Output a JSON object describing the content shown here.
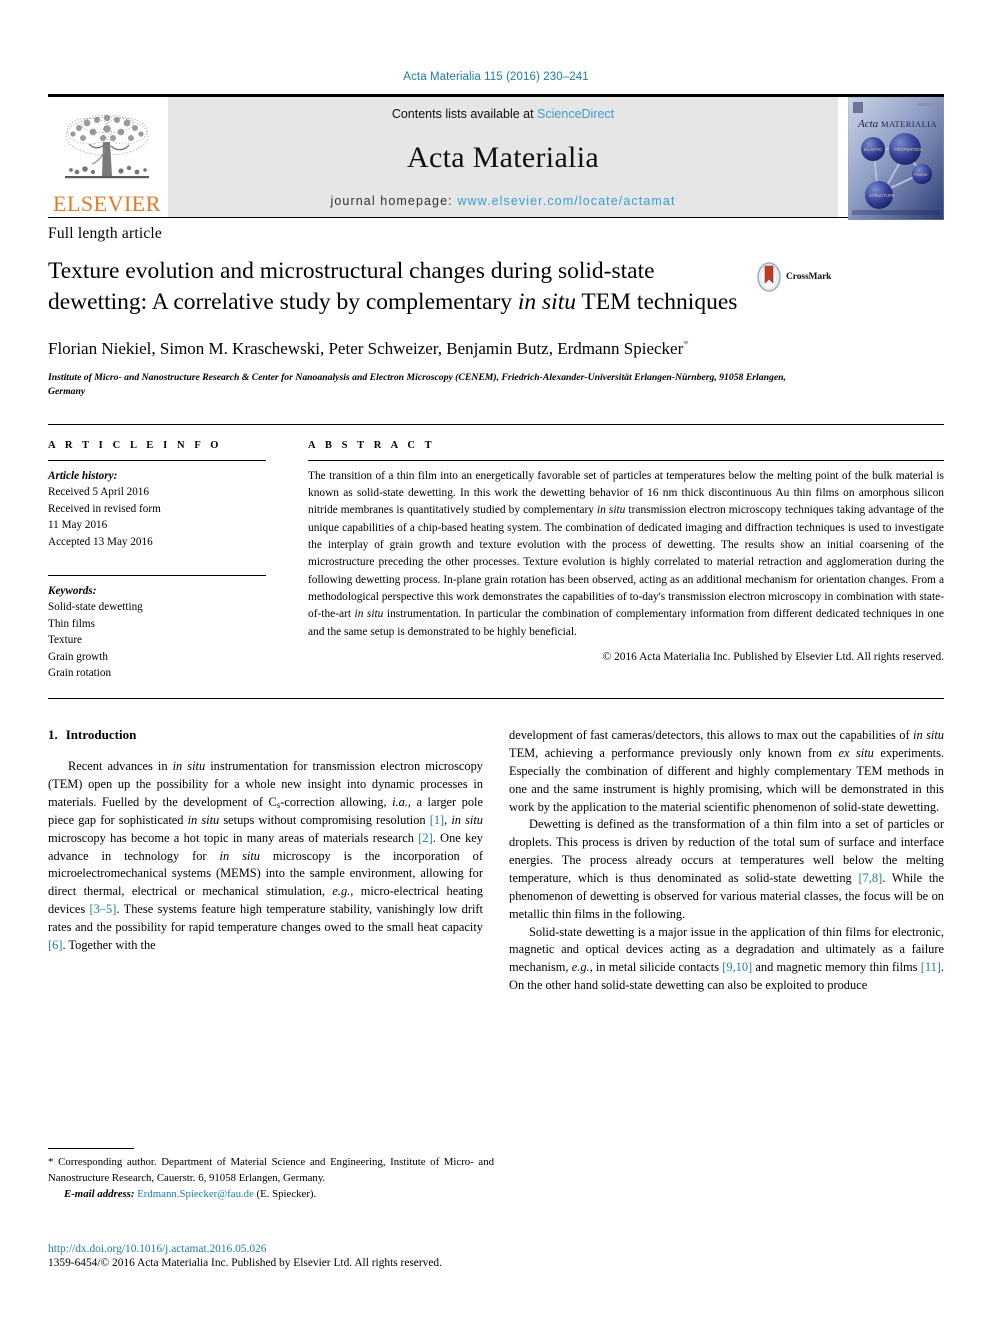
{
  "running_head": "Acta Materialia 115 (2016) 230–241",
  "masthead": {
    "publisher_name": "ELSEVIER",
    "contents_prefix": "Contents lists available at ",
    "contents_link": "ScienceDirect",
    "journal_title": "Acta Materialia",
    "homepage_prefix": "journal homepage: ",
    "homepage_link": "www.elsevier.com/locate/actamat",
    "cover_title_italic": "Acta",
    "cover_title_rest": "MATERIALIA"
  },
  "article": {
    "type": "Full length article",
    "title_part1": "Texture evolution and microstructural changes during solid-state dewetting: A correlative study by complementary ",
    "title_italic": "in situ",
    "title_part2": " TEM techniques",
    "crossmark_label": "CrossMark",
    "authors": "Florian Niekiel, Simon M. Kraschewski, Peter Schweizer, Benjamin Butz, Erdmann Spiecker",
    "author_marker": "*",
    "affiliation": "Institute of Micro- and Nanostructure Research & Center for Nanoanalysis and Electron Microscopy (CENEM), Friedrich-Alexander-Universität Erlangen-Nürnberg, 91058 Erlangen, Germany"
  },
  "article_info": {
    "heading": "A R T I C L E   I N F O",
    "history_label": "Article history:",
    "history_lines": [
      "Received 5 April 2016",
      "Received in revised form",
      "11 May 2016",
      "Accepted 13 May 2016"
    ],
    "keywords_label": "Keywords:",
    "keywords": [
      "Solid-state dewetting",
      "Thin films",
      "Texture",
      "Grain growth",
      "Grain rotation"
    ]
  },
  "abstract": {
    "heading": "A B S T R A C T",
    "p1": "The transition of a thin film into an energetically favorable set of particles at temperatures below the melting point of the bulk material is known as solid-state dewetting. In this work the dewetting behavior of 16 nm thick discontinuous Au thin films on amorphous silicon nitride membranes is quantitatively studied by complementary ",
    "italic1": "in situ",
    "p2": " transmission electron microscopy techniques taking advantage of the unique capabilities of a chip-based heating system. The combination of dedicated imaging and diffraction techniques is used to investigate the interplay of grain growth and texture evolution with the process of dewetting. The results show an initial coarsening of the microstructure preceding the other processes. Texture evolution is highly correlated to material retraction and agglomeration during the following dewetting process. In-plane grain rotation has been observed, acting as an additional mechanism for orientation changes. From a methodological perspective this work demonstrates the capabilities of to-day's transmission electron microscopy in combination with state-of-the-art ",
    "italic2": "in situ",
    "p3": " instrumentation. In particular the combination of complementary information from different dedicated techniques in one and the same setup is demonstrated to be highly beneficial.",
    "copyright": "© 2016 Acta Materialia Inc. Published by Elsevier Ltd. All rights reserved."
  },
  "introduction": {
    "number": "1.",
    "title": "Introduction",
    "left_p1_a": "Recent advances in ",
    "left_p1_i1": "in situ",
    "left_p1_b": " instrumentation for transmission electron microscopy (TEM) open up the possibility for a whole new insight into dynamic processes in materials. Fuelled by the development of C",
    "left_p1_sub": "s",
    "left_p1_c": "-correction allowing, ",
    "left_p1_i2": "i.a.",
    "left_p1_d": ", a larger pole piece gap for sophisticated ",
    "left_p1_i3": "in situ",
    "left_p1_e": " setups without compromising resolution ",
    "left_p1_r1": "[1]",
    "left_p1_f": ", ",
    "left_p1_i4": "in situ",
    "left_p1_g": " microscopy has become a hot topic in many areas of materials research ",
    "left_p1_r2": "[2]",
    "left_p1_h": ". One key advance in technology for ",
    "left_p1_i5": "in situ",
    "left_p1_j": " microscopy is the incorporation of microelectromechanical systems (MEMS) into the sample environment, allowing for direct thermal, electrical or mechanical stimulation, ",
    "left_p1_i6": "e.g.",
    "left_p1_k": ", micro-electrical heating devices ",
    "left_p1_r3": "[3–5]",
    "left_p1_l": ". These systems feature high temperature stability, vanishingly low drift rates and the possibility for rapid temperature changes owed to the small heat capacity ",
    "left_p1_r4": "[6]",
    "left_p1_m": ". Together with the",
    "right_p1_a": "development of fast cameras/detectors, this allows to max out the capabilities of ",
    "right_p1_i1": "in situ",
    "right_p1_b": " TEM, achieving a performance previously only known from ",
    "right_p1_i2": "ex situ",
    "right_p1_c": " experiments. Especially the combination of different and highly complementary TEM methods in one and the same instrument is highly promising, which will be demonstrated in this work by the application to the material scientific phenomenon of solid-state dewetting.",
    "right_p2": "Dewetting is defined as the transformation of a thin film into a set of particles or droplets. This process is driven by reduction of the total sum of surface and interface energies. The process already occurs at temperatures well below the melting temperature, which is thus denominated as solid-state dewetting ",
    "right_p2_r1": "[7,8]",
    "right_p2_b": ". While the phenomenon of dewetting is observed for various material classes, the focus will be on metallic thin films in the following.",
    "right_p3_a": "Solid-state dewetting is a major issue in the application of thin films for electronic, magnetic and optical devices acting as a degradation and ultimately as a failure mechanism, ",
    "right_p3_i1": "e.g.",
    "right_p3_b": ", in metal silicide contacts ",
    "right_p3_r1": "[9,10]",
    "right_p3_c": " and magnetic memory thin films ",
    "right_p3_r2": "[11]",
    "right_p3_d": ". On the other hand solid-state dewetting can also be exploited to produce"
  },
  "footnote": {
    "marker": "*",
    "text": " Corresponding author. Department of Material Science and Engineering, Institute of Micro- and Nanostructure Research, Cauerstr. 6, 91058 Erlangen, Germany.",
    "email_label": "E-mail address:",
    "email": "Erdmann.Spiecker@fau.de",
    "email_suffix": " (E. Spiecker)."
  },
  "doi": "http://dx.doi.org/10.1016/j.actamat.2016.05.026",
  "issn_line": "1359-6454/© 2016 Acta Materialia Inc. Published by Elsevier Ltd. All rights reserved.",
  "colors": {
    "link": "#1f7ba6",
    "elsevier_orange": "#E87722",
    "band_gray": "#e6e6e6",
    "sciencedirect_blue": "#3a9fd0"
  }
}
